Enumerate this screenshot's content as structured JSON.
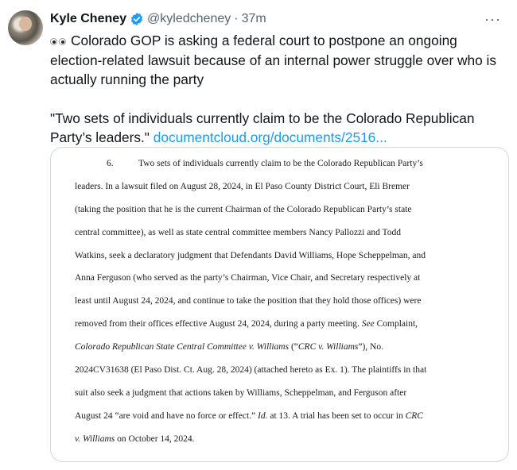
{
  "author": {
    "name": "Kyle Cheney",
    "handle": "@kyledcheney",
    "time": "37m",
    "more_label": "···"
  },
  "tweet": {
    "line1": "Colorado GOP is asking a federal court to postpone an ongoing",
    "line2": "election-related lawsuit because of an internal power struggle over who is",
    "line3": "actually running the party",
    "quote_line1": "\"Two sets of individuals currently claim to be the Colorado Republican",
    "quote_line2": "Party’s leaders.\"",
    "link": "documentcloud.org/documents/2516..."
  },
  "document": {
    "para_number": "6.",
    "lines": [
      "Two sets of individuals currently claim to be the Colorado Republican Party’s",
      "leaders. In a lawsuit filed on August 28, 2024, in El Paso County District Court, Eli Bremer",
      "(taking the position that he is the current Chairman of the Colorado Republican Party’s state",
      "central committee), as well as state central committee members Nancy Pallozzi and Todd",
      "Watkins, seek a declaratory judgment that Defendants David Williams, Hope Scheppelman, and",
      "Anna Ferguson (who served as the party’s Chairman, Vice Chair, and Secretary respectively at",
      "least until August 24, 2024, and continue to take the position that they hold those offices) were",
      "removed from their offices effective August 24, 2024, during a party meeting.",
      "Colorado Republican State Central Committee v. Williams",
      "2024CV31638 (El Paso Dist. Ct. Aug. 28, 2024) (attached hereto as Ex. 1). The plaintiffs in that",
      "suit also seek a judgment that actions taken by Williams, Scheppelman, and Ferguson after",
      "August 24 “are void and have no force or effect.”",
      "v. Williams"
    ],
    "line8_see": "See",
    "line8_tail": " Complaint,",
    "line9_mid": " (“",
    "line9_crc": "CRC v. Williams",
    "line9_tail": "”), No.",
    "line12_id": "Id.",
    "line12_tail": " at 13. A trial has been set to occur in ",
    "line12_crc": "CRC",
    "line13_tail": " on October 14, 2024."
  },
  "colors": {
    "link": "#1d9bf0",
    "verified": "#1d9bf0",
    "muted": "#536471",
    "border": "#cfd9de"
  }
}
